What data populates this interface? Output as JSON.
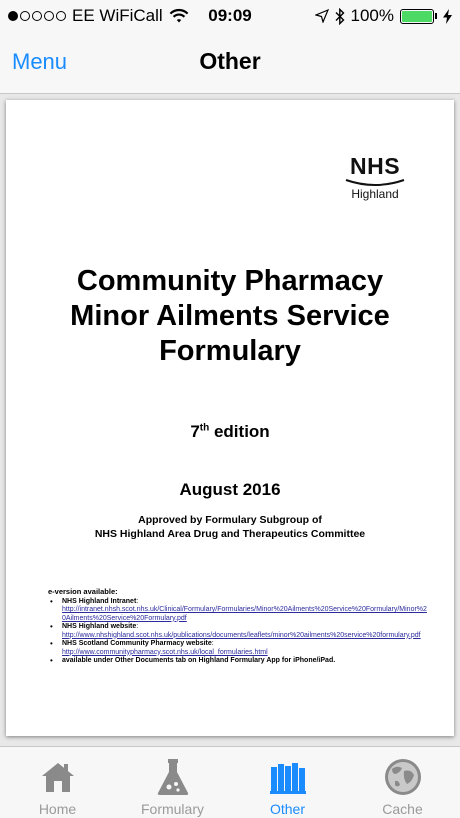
{
  "status_bar": {
    "carrier": "EE WiFiCall",
    "time": "09:09",
    "battery": "100%",
    "signal_bars_filled": 1,
    "signal_bars_total": 5
  },
  "nav": {
    "menu_label": "Menu",
    "title": "Other"
  },
  "document": {
    "logo_mark": "NHS",
    "logo_region": "Highland",
    "title_lines": [
      "Community Pharmacy",
      "Minor Ailments Service",
      "Formulary"
    ],
    "edition_number": "7",
    "edition_suffix": "th",
    "edition_word": "edition",
    "date": "August 2016",
    "approved_line1": "Approved by Formulary Subgroup of",
    "approved_line2": "NHS Highland Area Drug and Therapeutics Committee",
    "eversion_heading": "e-version available:",
    "eversion_items": [
      {
        "label": "NHS Highland Intranet",
        "url": "http://intranet.nhsh.scot.nhs.uk/Clinical/Formulary/Formularies/Minor%20Ailments%20Service%20Formulary/Minor%20Ailments%20Service%20Formulary.pdf"
      },
      {
        "label": "NHS Highland website",
        "url": "http://www.nhshighland.scot.nhs.uk/publications/documents/leaflets/minor%20ailments%20service%20formulary.pdf"
      },
      {
        "label": "NHS Scotland Community Pharmacy website",
        "url": "http://www.communitypharmacy.scot.nhs.uk/local_formularies.html"
      },
      {
        "label": "available under Other Documents tab on Highland Formulary App for iPhone/iPad.",
        "url": ""
      }
    ]
  },
  "tabs": [
    {
      "label": "Home",
      "icon": "house-icon"
    },
    {
      "label": "Formulary",
      "icon": "flask-icon"
    },
    {
      "label": "Other",
      "icon": "books-icon",
      "active": true
    },
    {
      "label": "Cache",
      "icon": "globe-icon"
    }
  ],
  "colors": {
    "accent": "#1a8cff",
    "inactive_tab": "#9a9a9a",
    "battery": "#4cd964"
  }
}
